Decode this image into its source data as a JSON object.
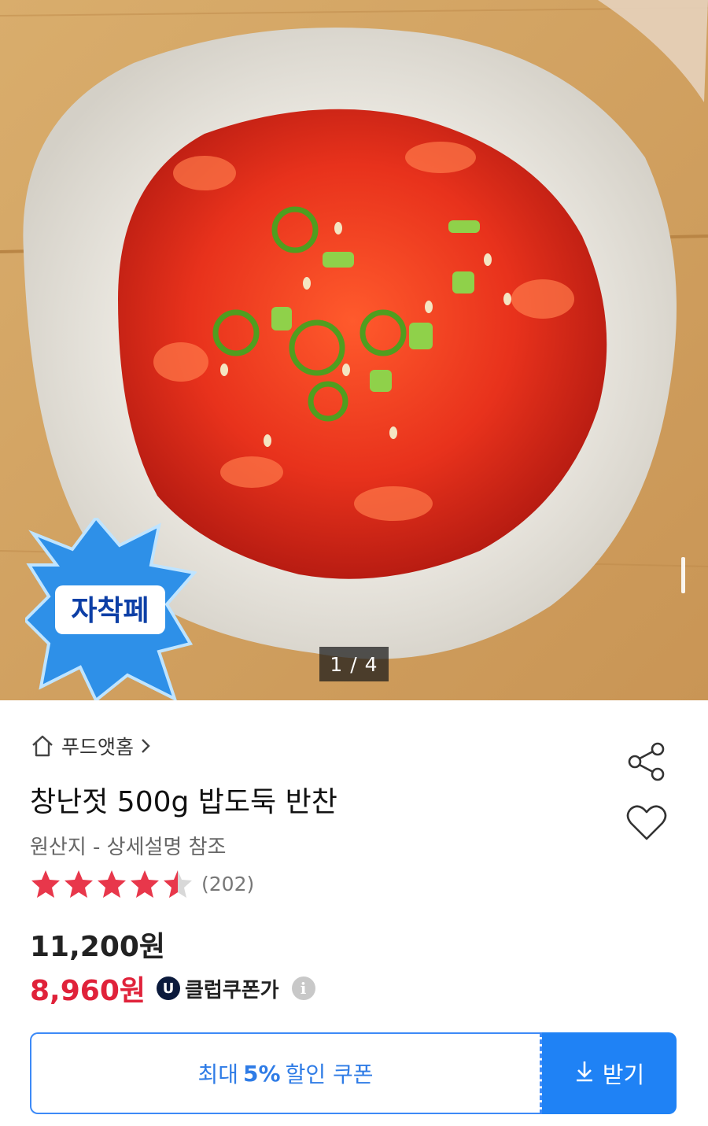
{
  "gallery": {
    "counter": "1 / 4",
    "badge_text": "자착페"
  },
  "product": {
    "store_name": "푸드앳홈",
    "title": "창난젓 500g 밥도둑 반찬",
    "origin": "원산지 - 상세설명 참조",
    "rating": 4.5,
    "rating_max": 5,
    "review_count": "(202)",
    "original_price": "11,200원",
    "sale_price": "8,960원",
    "club_badge": "U",
    "club_label": "클럽쿠폰가",
    "info_icon": "i"
  },
  "coupon": {
    "prefix": "최대",
    "percent": "5%",
    "suffix": "할인 쿠폰",
    "download_label": "받기"
  },
  "colors": {
    "accent": "#1f82f5",
    "sale": "#e0223a",
    "star": "#e8374b"
  },
  "icons": [
    "home-icon",
    "chevron-right-icon",
    "share-icon",
    "heart-icon",
    "star-icon",
    "download-icon",
    "info-icon"
  ]
}
